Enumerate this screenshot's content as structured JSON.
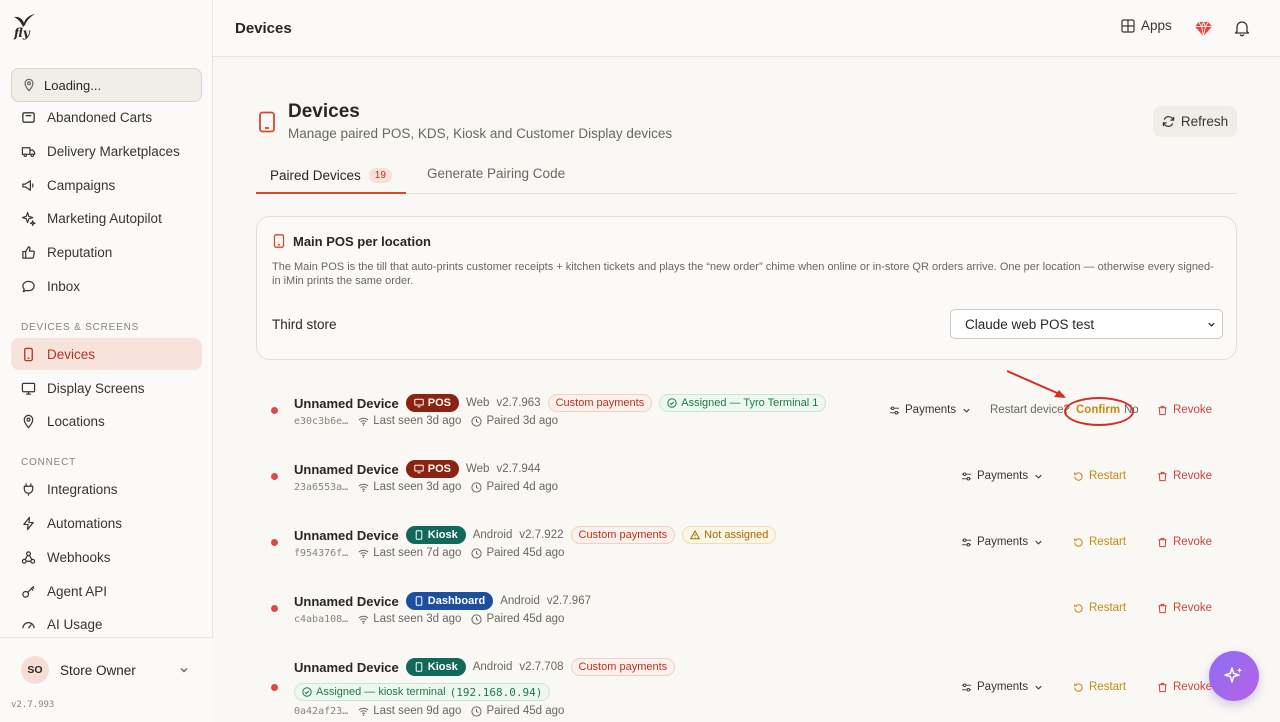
{
  "app": {
    "logo_text": "fly",
    "version": "v2.7.993"
  },
  "sidebar": {
    "location_picker": "Loading...",
    "items_top": [
      {
        "label": "Abandoned Carts"
      },
      {
        "label": "Delivery Marketplaces"
      },
      {
        "label": "Campaigns"
      },
      {
        "label": "Marketing Autopilot"
      },
      {
        "label": "Reputation"
      },
      {
        "label": "Inbox"
      }
    ],
    "section_devices": "DEVICES & SCREENS",
    "items_devices": [
      {
        "label": "Devices",
        "active": true
      },
      {
        "label": "Display Screens"
      },
      {
        "label": "Locations"
      }
    ],
    "section_connect": "CONNECT",
    "items_connect": [
      {
        "label": "Integrations"
      },
      {
        "label": "Automations"
      },
      {
        "label": "Webhooks"
      },
      {
        "label": "Agent API"
      },
      {
        "label": "AI Usage"
      }
    ],
    "user": {
      "initials": "SO",
      "name": "Store Owner"
    }
  },
  "topbar": {
    "title": "Devices",
    "apps_label": "Apps"
  },
  "header": {
    "title": "Devices",
    "subtitle": "Manage paired POS, KDS, Kiosk and Customer Display devices",
    "refresh_label": "Refresh"
  },
  "tabs": {
    "paired": {
      "label": "Paired Devices",
      "count": "19"
    },
    "generate": {
      "label": "Generate Pairing Code"
    }
  },
  "main_pos_card": {
    "title": "Main POS per location",
    "description": "The Main POS is the till that auto-prints customer receipts + kitchen tickets and plays the “new order” chime when online or in-store QR orders arrive. One per location — otherwise every signed-in iMin prints the same order.",
    "store_name": "Third store",
    "selected_device": "Claude web POS test"
  },
  "devices": [
    {
      "name": "Unnamed Device",
      "type": "POS",
      "platform": "Web",
      "version": "v2.7.963",
      "custom_payments": "Custom payments",
      "assignment": "Assigned — Tyro Terminal 1",
      "id": "e30c3b6e…",
      "last_seen": "Last seen 3d ago",
      "paired": "Paired 3d ago",
      "payments_label": "Payments",
      "restart_question": "Restart device?",
      "confirm_label": "Confirm",
      "no_label": "No",
      "revoke_label": "Revoke"
    },
    {
      "name": "Unnamed Device",
      "type": "POS",
      "platform": "Web",
      "version": "v2.7.944",
      "id": "23a6553a…",
      "last_seen": "Last seen 3d ago",
      "paired": "Paired 4d ago",
      "payments_label": "Payments",
      "restart_label": "Restart",
      "revoke_label": "Revoke"
    },
    {
      "name": "Unnamed Device",
      "type": "Kiosk",
      "platform": "Android",
      "version": "v2.7.922",
      "custom_payments": "Custom payments",
      "assignment": "Not assigned",
      "id": "f954376f…",
      "last_seen": "Last seen 7d ago",
      "paired": "Paired 45d ago",
      "payments_label": "Payments",
      "restart_label": "Restart",
      "revoke_label": "Revoke"
    },
    {
      "name": "Unnamed Device",
      "type": "Dashboard",
      "platform": "Android",
      "version": "v2.7.967",
      "id": "c4aba108…",
      "last_seen": "Last seen 3d ago",
      "paired": "Paired 45d ago",
      "restart_label": "Restart",
      "revoke_label": "Revoke"
    },
    {
      "name": "Unnamed Device",
      "type": "Kiosk",
      "platform": "Android",
      "version": "v2.7.708",
      "custom_payments": "Custom payments",
      "assignment_prefix": "Assigned — kiosk terminal",
      "assignment_ip": "(192.168.0.94)",
      "id": "0a42af23…",
      "last_seen": "Last seen 9d ago",
      "paired": "Paired 45d ago",
      "payments_label": "Payments",
      "restart_label": "Restart",
      "revoke_label": "Revoke"
    }
  ],
  "colors": {
    "accent": "#d9482b",
    "online_dot": "#e04848",
    "restart": "#c78a14",
    "revoke": "#d0413a",
    "annotation": "#d62d20"
  }
}
